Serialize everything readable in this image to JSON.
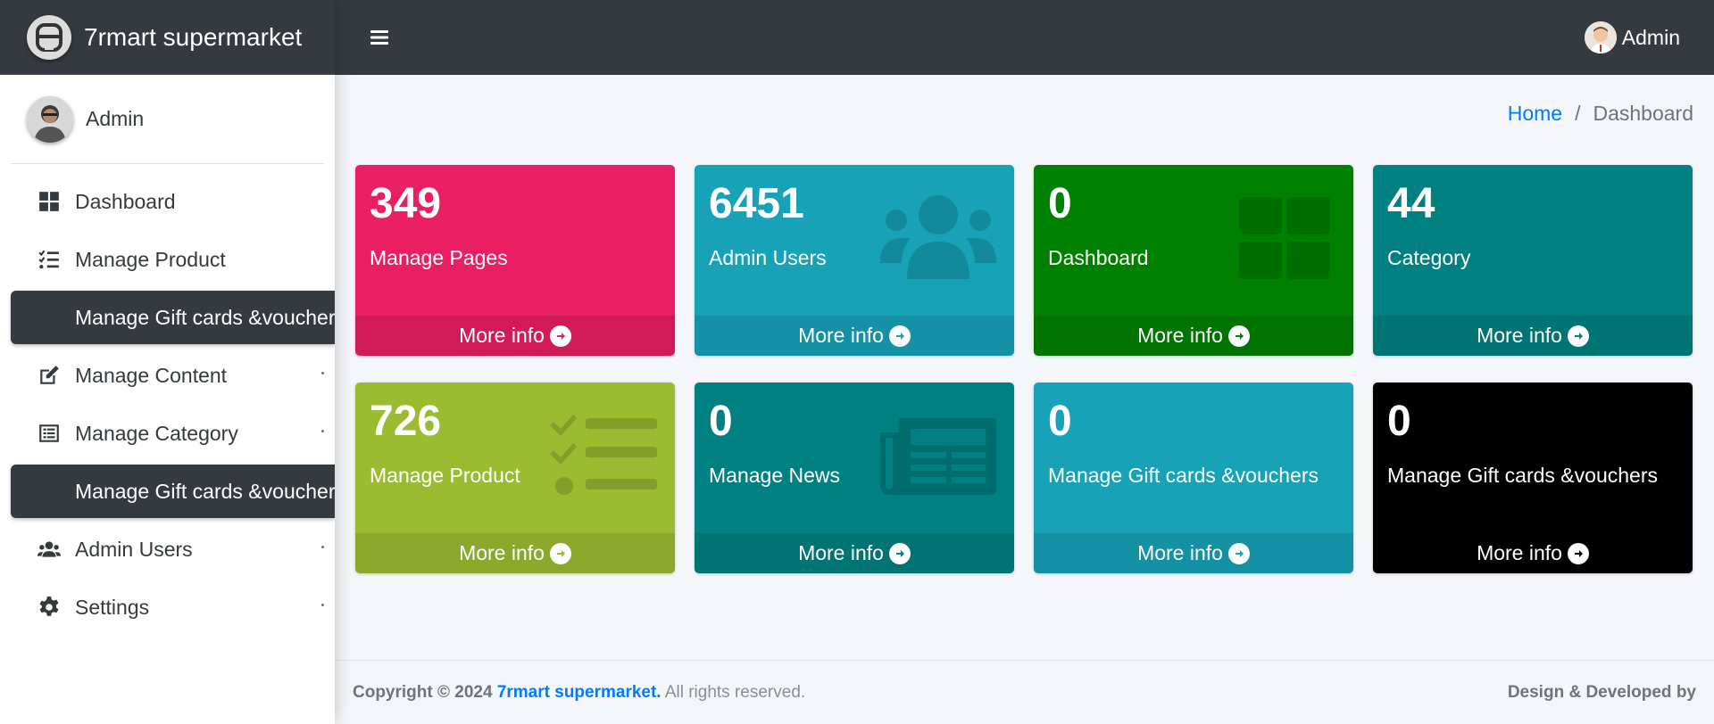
{
  "brand": {
    "name": "7rmart supermarket"
  },
  "sidebar": {
    "user_name": "Admin",
    "items": [
      {
        "label": "Dashboard",
        "icon": "dashboard-icon",
        "active": false
      },
      {
        "label": "Manage Product",
        "icon": "tasks-icon",
        "active": false
      },
      {
        "label": "Manage Gift cards &vouchers",
        "icon": "",
        "active": true
      },
      {
        "label": "Manage Content",
        "icon": "edit-icon",
        "active": false
      },
      {
        "label": "Manage Category",
        "icon": "list-alt-icon",
        "active": false
      },
      {
        "label": "Manage Gift cards &vouchers",
        "icon": "",
        "active": true
      },
      {
        "label": "Admin Users",
        "icon": "users-icon",
        "active": false
      },
      {
        "label": "Settings",
        "icon": "gear-icon",
        "active": false
      }
    ]
  },
  "topbar": {
    "user_name": "Admin"
  },
  "breadcrumb": {
    "home": "Home",
    "separator": "/",
    "current": "Dashboard"
  },
  "boxes": [
    {
      "count": "349",
      "label": "Manage Pages",
      "color": "#e91e63",
      "icon": "",
      "footer": "More info"
    },
    {
      "count": "6451",
      "label": "Admin Users",
      "color": "#17a2b8",
      "icon": "users-icon",
      "footer": "More info"
    },
    {
      "count": "0",
      "label": "Dashboard",
      "color": "#008000",
      "icon": "dashboard-icon",
      "footer": "More info"
    },
    {
      "count": "44",
      "label": "Category",
      "color": "#008080",
      "icon": "",
      "footer": "More info"
    },
    {
      "count": "726",
      "label": "Manage Product",
      "color": "#9bbb30",
      "icon": "tasks-icon",
      "footer": "More info"
    },
    {
      "count": "0",
      "label": "Manage News",
      "color": "#008080",
      "icon": "newspaper-icon",
      "footer": "More info"
    },
    {
      "count": "0",
      "label": "Manage Gift cards &vouchers",
      "color": "#17a2b8",
      "icon": "",
      "footer": "More info"
    },
    {
      "count": "0",
      "label": "Manage Gift cards &vouchers",
      "color": "#000000",
      "icon": "",
      "footer": "More info"
    }
  ],
  "footer": {
    "copyright": "Copyright © 2024",
    "brand": "7rmart supermarket.",
    "rights": "All rights reserved.",
    "credit": "Design & Developed by"
  }
}
